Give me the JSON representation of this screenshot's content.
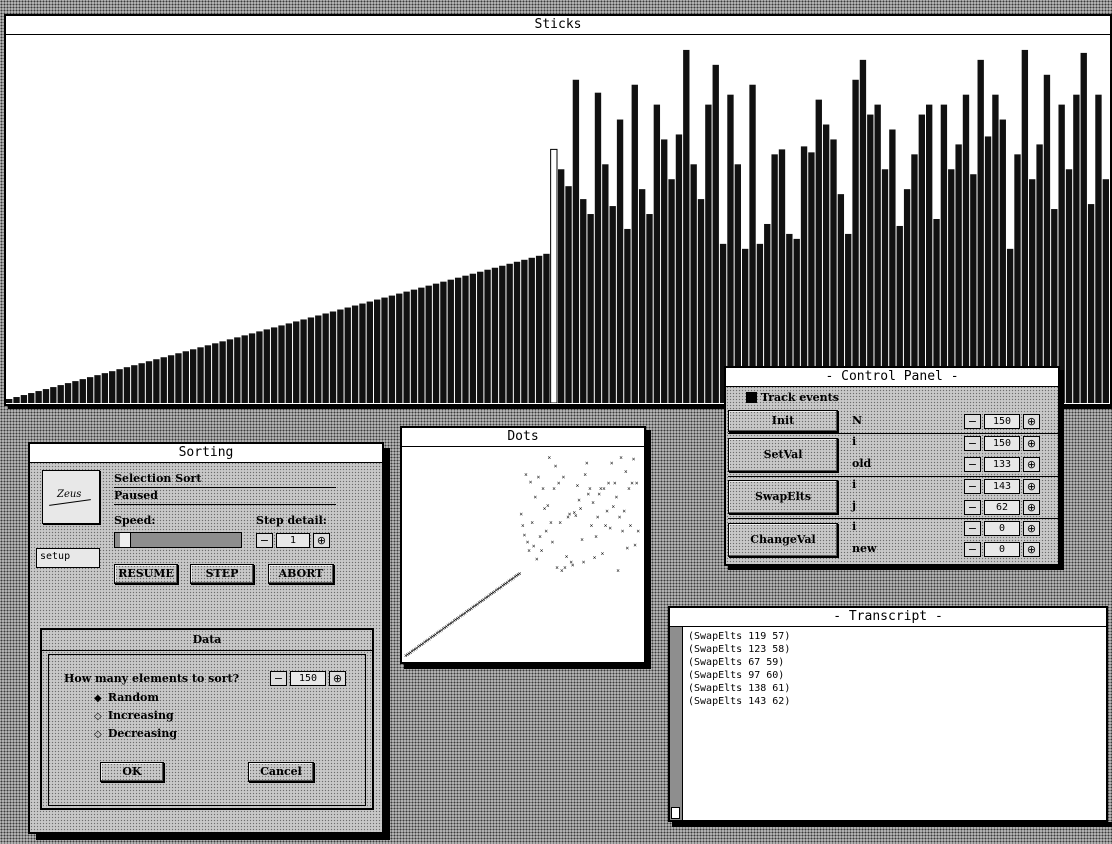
{
  "sticks": {
    "title": "Sticks",
    "values": [
      4,
      6,
      8,
      10,
      12,
      14,
      16,
      18,
      20,
      22,
      24,
      26,
      28,
      30,
      32,
      34,
      36,
      38,
      40,
      42,
      44,
      46,
      48,
      50,
      52,
      54,
      56,
      58,
      60,
      62,
      64,
      66,
      68,
      70,
      72,
      74,
      76,
      78,
      80,
      82,
      84,
      86,
      88,
      90,
      92,
      94,
      96,
      98,
      100,
      102,
      104,
      106,
      108,
      110,
      112,
      114,
      116,
      118,
      120,
      122,
      124,
      126,
      128,
      130,
      132,
      134,
      136,
      138,
      140,
      142,
      144,
      146,
      148,
      150,
      255,
      235,
      218,
      325,
      205,
      190,
      312,
      240,
      198,
      285,
      175,
      320,
      215,
      190,
      300,
      265,
      225,
      270,
      355,
      240,
      205,
      300,
      340,
      160,
      310,
      240,
      155,
      320,
      160,
      180,
      250,
      255,
      170,
      165,
      258,
      252,
      305,
      280,
      265,
      210,
      170,
      325,
      345,
      290,
      300,
      235,
      275,
      178,
      215,
      250,
      290,
      300,
      185,
      300,
      235,
      260,
      310,
      230,
      345,
      268,
      310,
      285,
      155,
      250,
      355,
      225,
      260,
      330,
      195,
      300,
      235,
      310,
      352,
      200,
      310,
      225
    ],
    "max_value": 370,
    "highlight_index": 74
  },
  "sorting": {
    "title": "Sorting",
    "logo_text": "Zeus",
    "algorithm": "Selection Sort",
    "status": "Paused",
    "speed_label": "Speed:",
    "speed_level": 0.04,
    "step_detail_label": "Step detail:",
    "step_detail_value": "1",
    "setup_label": "setup",
    "resume_label": "RESUME",
    "step_label": "STEP",
    "abort_label": "ABORT"
  },
  "data_dialog": {
    "title": "Data",
    "question": "How many elements to sort?",
    "count": "150",
    "options": [
      "Random",
      "Increasing",
      "Decreasing"
    ],
    "selected": 0,
    "ok_label": "OK",
    "cancel_label": "Cancel"
  },
  "dots": {
    "title": "Dots"
  },
  "control_panel": {
    "title": "- Control Panel -",
    "track_events": "Track events",
    "rows": [
      {
        "button": "Init",
        "fields": [
          {
            "label": "N",
            "value": "150"
          }
        ]
      },
      {
        "button": "SetVal",
        "fields": [
          {
            "label": "i",
            "value": "150"
          },
          {
            "label": "old",
            "value": "133"
          }
        ]
      },
      {
        "button": "SwapElts",
        "fields": [
          {
            "label": "i",
            "value": "143"
          },
          {
            "label": "j",
            "value": "62"
          }
        ]
      },
      {
        "button": "ChangeVal",
        "fields": [
          {
            "label": "i",
            "value": "0"
          },
          {
            "label": "new",
            "value": "0"
          }
        ]
      }
    ]
  },
  "transcript": {
    "title": "- Transcript -",
    "lines": [
      "(SwapElts 119 57)",
      "(SwapElts 123 58)",
      "(SwapElts 67 59)",
      "(SwapElts 97 60)",
      "(SwapElts 138 61)",
      "(SwapElts 143 62)"
    ]
  }
}
